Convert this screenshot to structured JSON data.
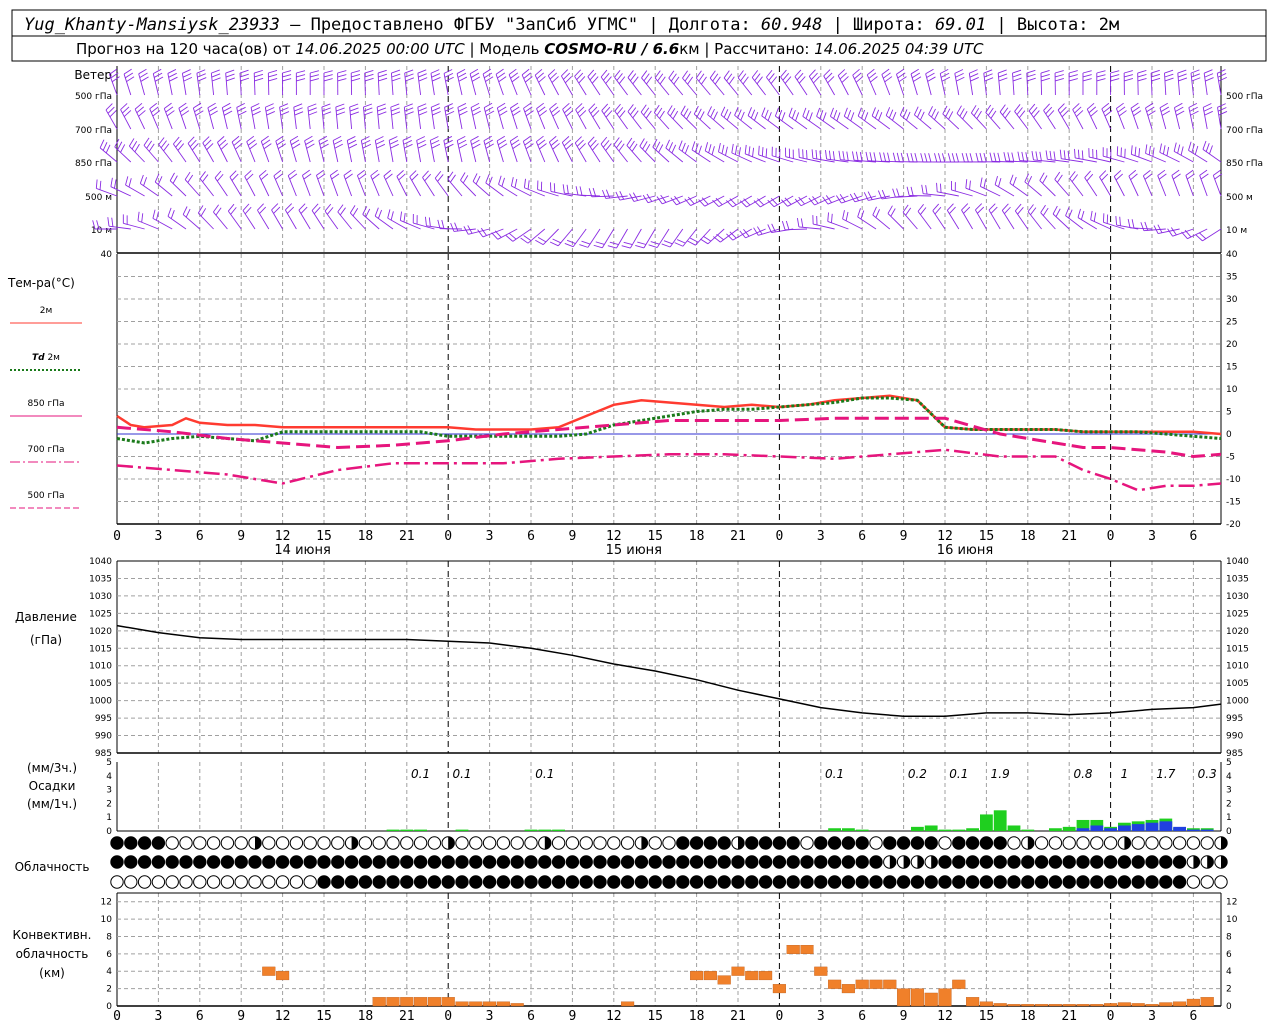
{
  "header": {
    "station": "Yug_Khanty-Mansiysk_23933",
    "provided_by": " – Предоставлено ФГБУ \"ЗапСиб УГМС\" | Долгота: ",
    "lon": "60.948",
    "lat_label": " | Широта: ",
    "lat": "69.01",
    "alt_label": " | Высота: 2м",
    "forecast_label": "Прогноз на 120 часа(ов) от ",
    "forecast_time": "14.06.2025 00:00 UTC",
    "model_label": "  | Модель ",
    "model": "COSMO-RU / 6.6",
    "model_unit": "км",
    "calc_label": " | Рассчитано: ",
    "calc_time": "14.06.2025 04:39 UTC"
  },
  "colors": {
    "wind": "#8a2be2",
    "t2m": "#ff3b30",
    "td2m": "#1a7a1a",
    "t850": "#e6157d",
    "t700": "#e6157d",
    "t500": "#e6157d",
    "zero": "#3030d0",
    "pressure": "#000000",
    "precip3h": "#1fcf1f",
    "precip1h": "#2040e0",
    "conv": "#f0802a",
    "grid": "#a0a0a0"
  },
  "wind_panel": {
    "title": "Ветер",
    "levels": [
      "500 гПа",
      "700 гПа",
      "850 гПа",
      "500 м",
      "10 м"
    ],
    "levels_right": [
      "500 гПа",
      "700 гПа",
      "850 гПа",
      "500 м",
      "10 м"
    ]
  },
  "temp_panel": {
    "title": "Тем-ра(°С)",
    "legend": [
      {
        "label": "2м",
        "style": "solid",
        "color": "#ff3b30"
      },
      {
        "label": "Td 2м",
        "style": "dotted",
        "color": "#1a7a1a"
      },
      {
        "label": "850 гПа",
        "style": "solid",
        "color": "#e6157d"
      },
      {
        "label": "700 гПа",
        "style": "dashdot",
        "color": "#e6157d"
      },
      {
        "label": "500 гПа",
        "style": "dashed",
        "color": "#e6157d"
      }
    ],
    "td_italic": "Td",
    "td_rest": " 2м"
  },
  "time_axis": {
    "hour_labels": [
      "0",
      "3",
      "6",
      "9",
      "12",
      "15",
      "18",
      "21",
      "0",
      "3",
      "6",
      "9",
      "12",
      "15",
      "18",
      "21",
      "0",
      "3",
      "6",
      "9",
      "12",
      "15",
      "18",
      "21",
      "0",
      "3",
      "6"
    ],
    "dates": [
      "14 июня",
      "15 июня",
      "16 июня"
    ]
  },
  "pressure_panel": {
    "title": "Давление",
    "unit": "(гПа)"
  },
  "precip_panel": {
    "unit3h": "(мм/3ч.)",
    "title": "Осадки",
    "unit1h": "(мм/1ч.)",
    "labels": [
      {
        "h": 22,
        "text": "0.1"
      },
      {
        "h": 25,
        "text": "0.1"
      },
      {
        "h": 31,
        "text": "0.1"
      },
      {
        "h": 52,
        "text": "0.1"
      },
      {
        "h": 58,
        "text": "0.2"
      },
      {
        "h": 61,
        "text": "0.1"
      },
      {
        "h": 64,
        "text": "1.9"
      },
      {
        "h": 70,
        "text": "0.8"
      },
      {
        "h": 73,
        "text": "1"
      },
      {
        "h": 76,
        "text": "1.7"
      },
      {
        "h": 79,
        "text": "0.3"
      }
    ]
  },
  "cloud_panel": {
    "title": "Облачность"
  },
  "conv_panel": {
    "title1": "Конвективн.",
    "title2": "облачность",
    "unit": "(км)"
  },
  "chart_data": [
    {
      "type": "line",
      "title": "Тем-ра(°С)",
      "x_unit": "hours since 14.06.2025 00:00 UTC",
      "ylim": [
        -20,
        40
      ],
      "grid": true,
      "series": [
        {
          "name": "2м",
          "x": [
            0,
            1,
            2,
            4,
            5,
            6,
            8,
            10,
            12,
            14,
            16,
            18,
            20,
            22,
            24,
            26,
            28,
            30,
            32,
            34,
            36,
            38,
            40,
            42,
            44,
            46,
            48,
            50,
            52,
            54,
            56,
            58,
            60,
            62,
            64,
            66,
            68,
            70,
            72,
            74,
            76,
            78,
            80
          ],
          "y": [
            4,
            2,
            1.5,
            2,
            3.5,
            2.5,
            2,
            2,
            1.5,
            1.5,
            1.5,
            1.5,
            1.5,
            1.5,
            1.5,
            1,
            1,
            1,
            1.5,
            4,
            6.5,
            7.5,
            7,
            6.5,
            6,
            6.5,
            6,
            6.5,
            7.5,
            8,
            8.5,
            7.5,
            1.5,
            1,
            1,
            1,
            1,
            0.5,
            0.5,
            0.5,
            0.5,
            0.5,
            0
          ]
        },
        {
          "name": "Td 2м",
          "x": [
            0,
            2,
            4,
            6,
            8,
            10,
            12,
            14,
            16,
            18,
            20,
            22,
            24,
            26,
            28,
            30,
            32,
            34,
            36,
            38,
            40,
            42,
            44,
            46,
            48,
            50,
            52,
            54,
            56,
            58,
            60,
            62,
            64,
            66,
            68,
            70,
            72,
            74,
            76,
            78,
            80
          ],
          "y": [
            -1,
            -2,
            -1,
            -0.5,
            -1,
            -1.5,
            0.5,
            0.5,
            0.5,
            0.5,
            0.5,
            0.5,
            -0.5,
            -0.5,
            -0.5,
            -0.5,
            -0.5,
            0,
            2,
            3,
            4,
            5,
            5.5,
            5.5,
            6,
            6.5,
            7,
            8,
            8,
            7.5,
            1.5,
            1,
            1,
            1,
            1,
            0.5,
            0.5,
            0.5,
            0,
            -0.5,
            -1
          ]
        },
        {
          "name": "850 гПа",
          "x": [
            0,
            4,
            8,
            12,
            16,
            20,
            24,
            28,
            32,
            36,
            40,
            44,
            48,
            52,
            56,
            60,
            64,
            68,
            70,
            72,
            76,
            78,
            80
          ],
          "y": [
            1.5,
            0.5,
            -1,
            -2,
            -3,
            -2.5,
            -1.5,
            0,
            1,
            2,
            3,
            3,
            3,
            3.5,
            3.5,
            3.5,
            0,
            -2,
            -3,
            -3,
            -4,
            -5,
            -4.5
          ]
        },
        {
          "name": "700 гПа",
          "x": [
            0,
            4,
            8,
            12,
            16,
            20,
            24,
            28,
            32,
            36,
            40,
            44,
            48,
            52,
            56,
            60,
            64,
            68,
            70,
            72,
            74,
            76,
            78,
            80
          ],
          "y": [
            -7,
            -8,
            -9,
            -11,
            -8,
            -6.5,
            -6.5,
            -6.5,
            -5.5,
            -5,
            -4.5,
            -4.5,
            -5,
            -5.5,
            -4.5,
            -3.5,
            -5,
            -5,
            -8,
            -10,
            -12.5,
            -11.5,
            -11.5,
            -11
          ]
        }
      ]
    },
    {
      "type": "line",
      "title": "Давление",
      "x_unit": "hours since 14.06.2025 00:00 UTC",
      "ylim": [
        985,
        1040
      ],
      "grid": true,
      "series": [
        {
          "name": "Давление",
          "x": [
            0,
            3,
            6,
            9,
            12,
            15,
            18,
            21,
            24,
            27,
            30,
            33,
            36,
            39,
            42,
            45,
            48,
            51,
            54,
            57,
            60,
            63,
            66,
            69,
            72,
            75,
            78,
            80
          ],
          "y": [
            1021.5,
            1019.5,
            1018,
            1017.5,
            1017.5,
            1017.5,
            1017.5,
            1017.5,
            1017,
            1016.5,
            1015,
            1013,
            1010.5,
            1008.5,
            1006,
            1003,
            1000.5,
            998,
            996.5,
            995.5,
            995.5,
            996.5,
            996.5,
            996,
            996.5,
            997.5,
            998,
            999
          ]
        }
      ]
    },
    {
      "type": "bar",
      "title": "Осадки",
      "ylim": [
        0,
        5
      ],
      "series": [
        {
          "name": "(мм/3ч.)",
          "x": [
            20,
            21,
            22,
            23,
            24,
            25,
            26,
            27,
            28,
            29,
            30,
            31,
            32,
            52,
            53,
            54,
            55,
            56,
            57,
            58,
            59,
            60,
            61,
            62,
            63,
            64,
            65,
            66,
            67,
            68,
            69,
            70,
            71,
            72,
            73,
            74,
            75,
            76,
            77,
            78,
            79
          ],
          "y": [
            0.1,
            0.1,
            0.1,
            0,
            0,
            0.1,
            0,
            0,
            0,
            0,
            0.1,
            0.1,
            0.1,
            0.2,
            0.2,
            0.1,
            0,
            0,
            0,
            0.3,
            0.4,
            0.1,
            0.1,
            0.2,
            1.2,
            1.5,
            0.4,
            0.1,
            0,
            0.2,
            0.3,
            0.8,
            0.8,
            0.3,
            0.6,
            0.7,
            0.8,
            0.9,
            0.2,
            0.2,
            0.2
          ]
        },
        {
          "name": "(мм/1ч.)",
          "x": [
            70,
            71,
            72,
            73,
            74,
            75,
            76,
            77,
            78,
            79
          ],
          "y": [
            0.2,
            0.4,
            0.2,
            0.4,
            0.5,
            0.6,
            0.7,
            0.3,
            0.1,
            0.1
          ]
        }
      ]
    },
    {
      "type": "bar",
      "title": "Конвективн. облачность",
      "ylim": [
        0,
        13
      ],
      "series": [
        {
          "name": "(км)",
          "x": [
            11,
            12,
            19,
            20,
            21,
            22,
            23,
            24,
            25,
            26,
            27,
            28,
            29,
            37,
            42,
            43,
            44,
            45,
            46,
            47,
            48,
            49,
            50,
            51,
            52,
            53,
            54,
            55,
            56,
            57,
            58,
            59,
            60,
            61,
            62,
            63,
            64,
            65,
            66,
            67,
            68,
            69,
            70,
            71,
            72,
            73,
            74,
            75,
            76,
            77,
            78,
            79
          ],
          "y": [
            4.5,
            4,
            1,
            1,
            1,
            1,
            1,
            1,
            0.5,
            0.5,
            0.5,
            0.5,
            0.3,
            0.5,
            4,
            4,
            3.5,
            4.5,
            4,
            4,
            2.5,
            7,
            7,
            4.5,
            3,
            2.5,
            3,
            3,
            3,
            2,
            2,
            1.5,
            2,
            3,
            1,
            0.5,
            0.3,
            0.2,
            0.2,
            0.2,
            0.2,
            0.2,
            0.2,
            0.2,
            0.3,
            0.4,
            0.3,
            0.2,
            0.4,
            0.5,
            0.8,
            1
          ]
        }
      ]
    }
  ]
}
